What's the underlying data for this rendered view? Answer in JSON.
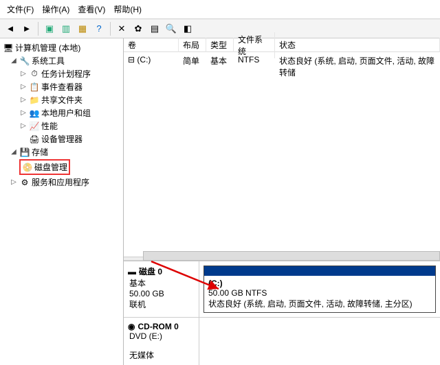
{
  "menu": {
    "file": "文件(F)",
    "action": "操作(A)",
    "view": "查看(V)",
    "help": "帮助(H)"
  },
  "tree": {
    "root": "计算机管理 (本地)",
    "sys_tools": "系统工具",
    "task_sched": "任务计划程序",
    "event_viewer": "事件查看器",
    "shared": "共享文件夹",
    "local_users": "本地用户和组",
    "perf": "性能",
    "dev_mgr": "设备管理器",
    "storage": "存储",
    "disk_mgmt": "磁盘管理",
    "services": "服务和应用程序"
  },
  "cols": {
    "volume": "卷",
    "layout": "布局",
    "type": "类型",
    "fs": "文件系统",
    "status": "状态"
  },
  "volrow": {
    "volume": "(C:)",
    "layout": "简单",
    "type": "基本",
    "fs": "NTFS",
    "status": "状态良好 (系统, 启动, 页面文件, 活动, 故障转储"
  },
  "disk0": {
    "title": "磁盘 0",
    "type": "基本",
    "size": "50.00 GB",
    "state": "联机",
    "part_name": "(C:)",
    "part_size": "50.00 GB NTFS",
    "part_status": "状态良好 (系统, 启动, 页面文件, 活动, 故障转储, 主分区)"
  },
  "cd0": {
    "title": "CD-ROM 0",
    "drive": "DVD (E:)",
    "state": "无媒体"
  }
}
